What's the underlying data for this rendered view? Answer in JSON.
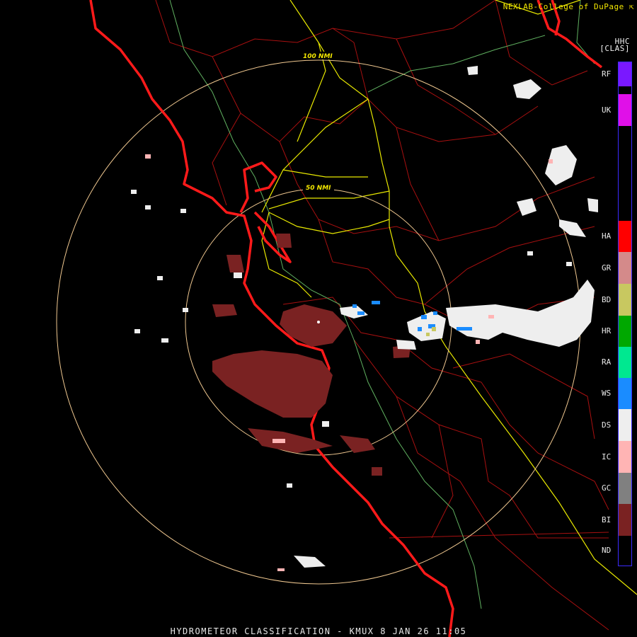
{
  "header": {
    "credit": "NEXLAB-College of DuPage",
    "credit_icon": "external-link-icon",
    "product_code": "HHC",
    "mode": "[CLAS]"
  },
  "footer": {
    "title": "HYDROMETEOR CLASSIFICATION - KMUX 8 JAN 26 11:05"
  },
  "range_rings": [
    {
      "label": "100 NMI"
    },
    {
      "label": "50 NMI"
    }
  ],
  "legend": [
    {
      "code": "RF",
      "color": "#7a18ff"
    },
    {
      "code": "UK",
      "color": "#e010e8"
    },
    {
      "code": "HA",
      "color": "#ff0000"
    },
    {
      "code": "GR",
      "color": "#d48a8a"
    },
    {
      "code": "BD",
      "color": "#c8c860"
    },
    {
      "code": "HR",
      "color": "#00a800"
    },
    {
      "code": "RA",
      "color": "#00e890"
    },
    {
      "code": "WS",
      "color": "#1a8cff"
    },
    {
      "code": "DS",
      "color": "#eeeeee"
    },
    {
      "code": "IC",
      "color": "#ffb4b4"
    },
    {
      "code": "GC",
      "color": "#808080"
    },
    {
      "code": "BI",
      "color": "#7a2222"
    },
    {
      "code": "ND",
      "color": "#000000"
    }
  ],
  "colors": {
    "coastline": "#ff1a1a",
    "county_borders": "#b01010",
    "highways": "#e8e800",
    "rivers": "#70c070",
    "range_rings": "#f0c890"
  }
}
